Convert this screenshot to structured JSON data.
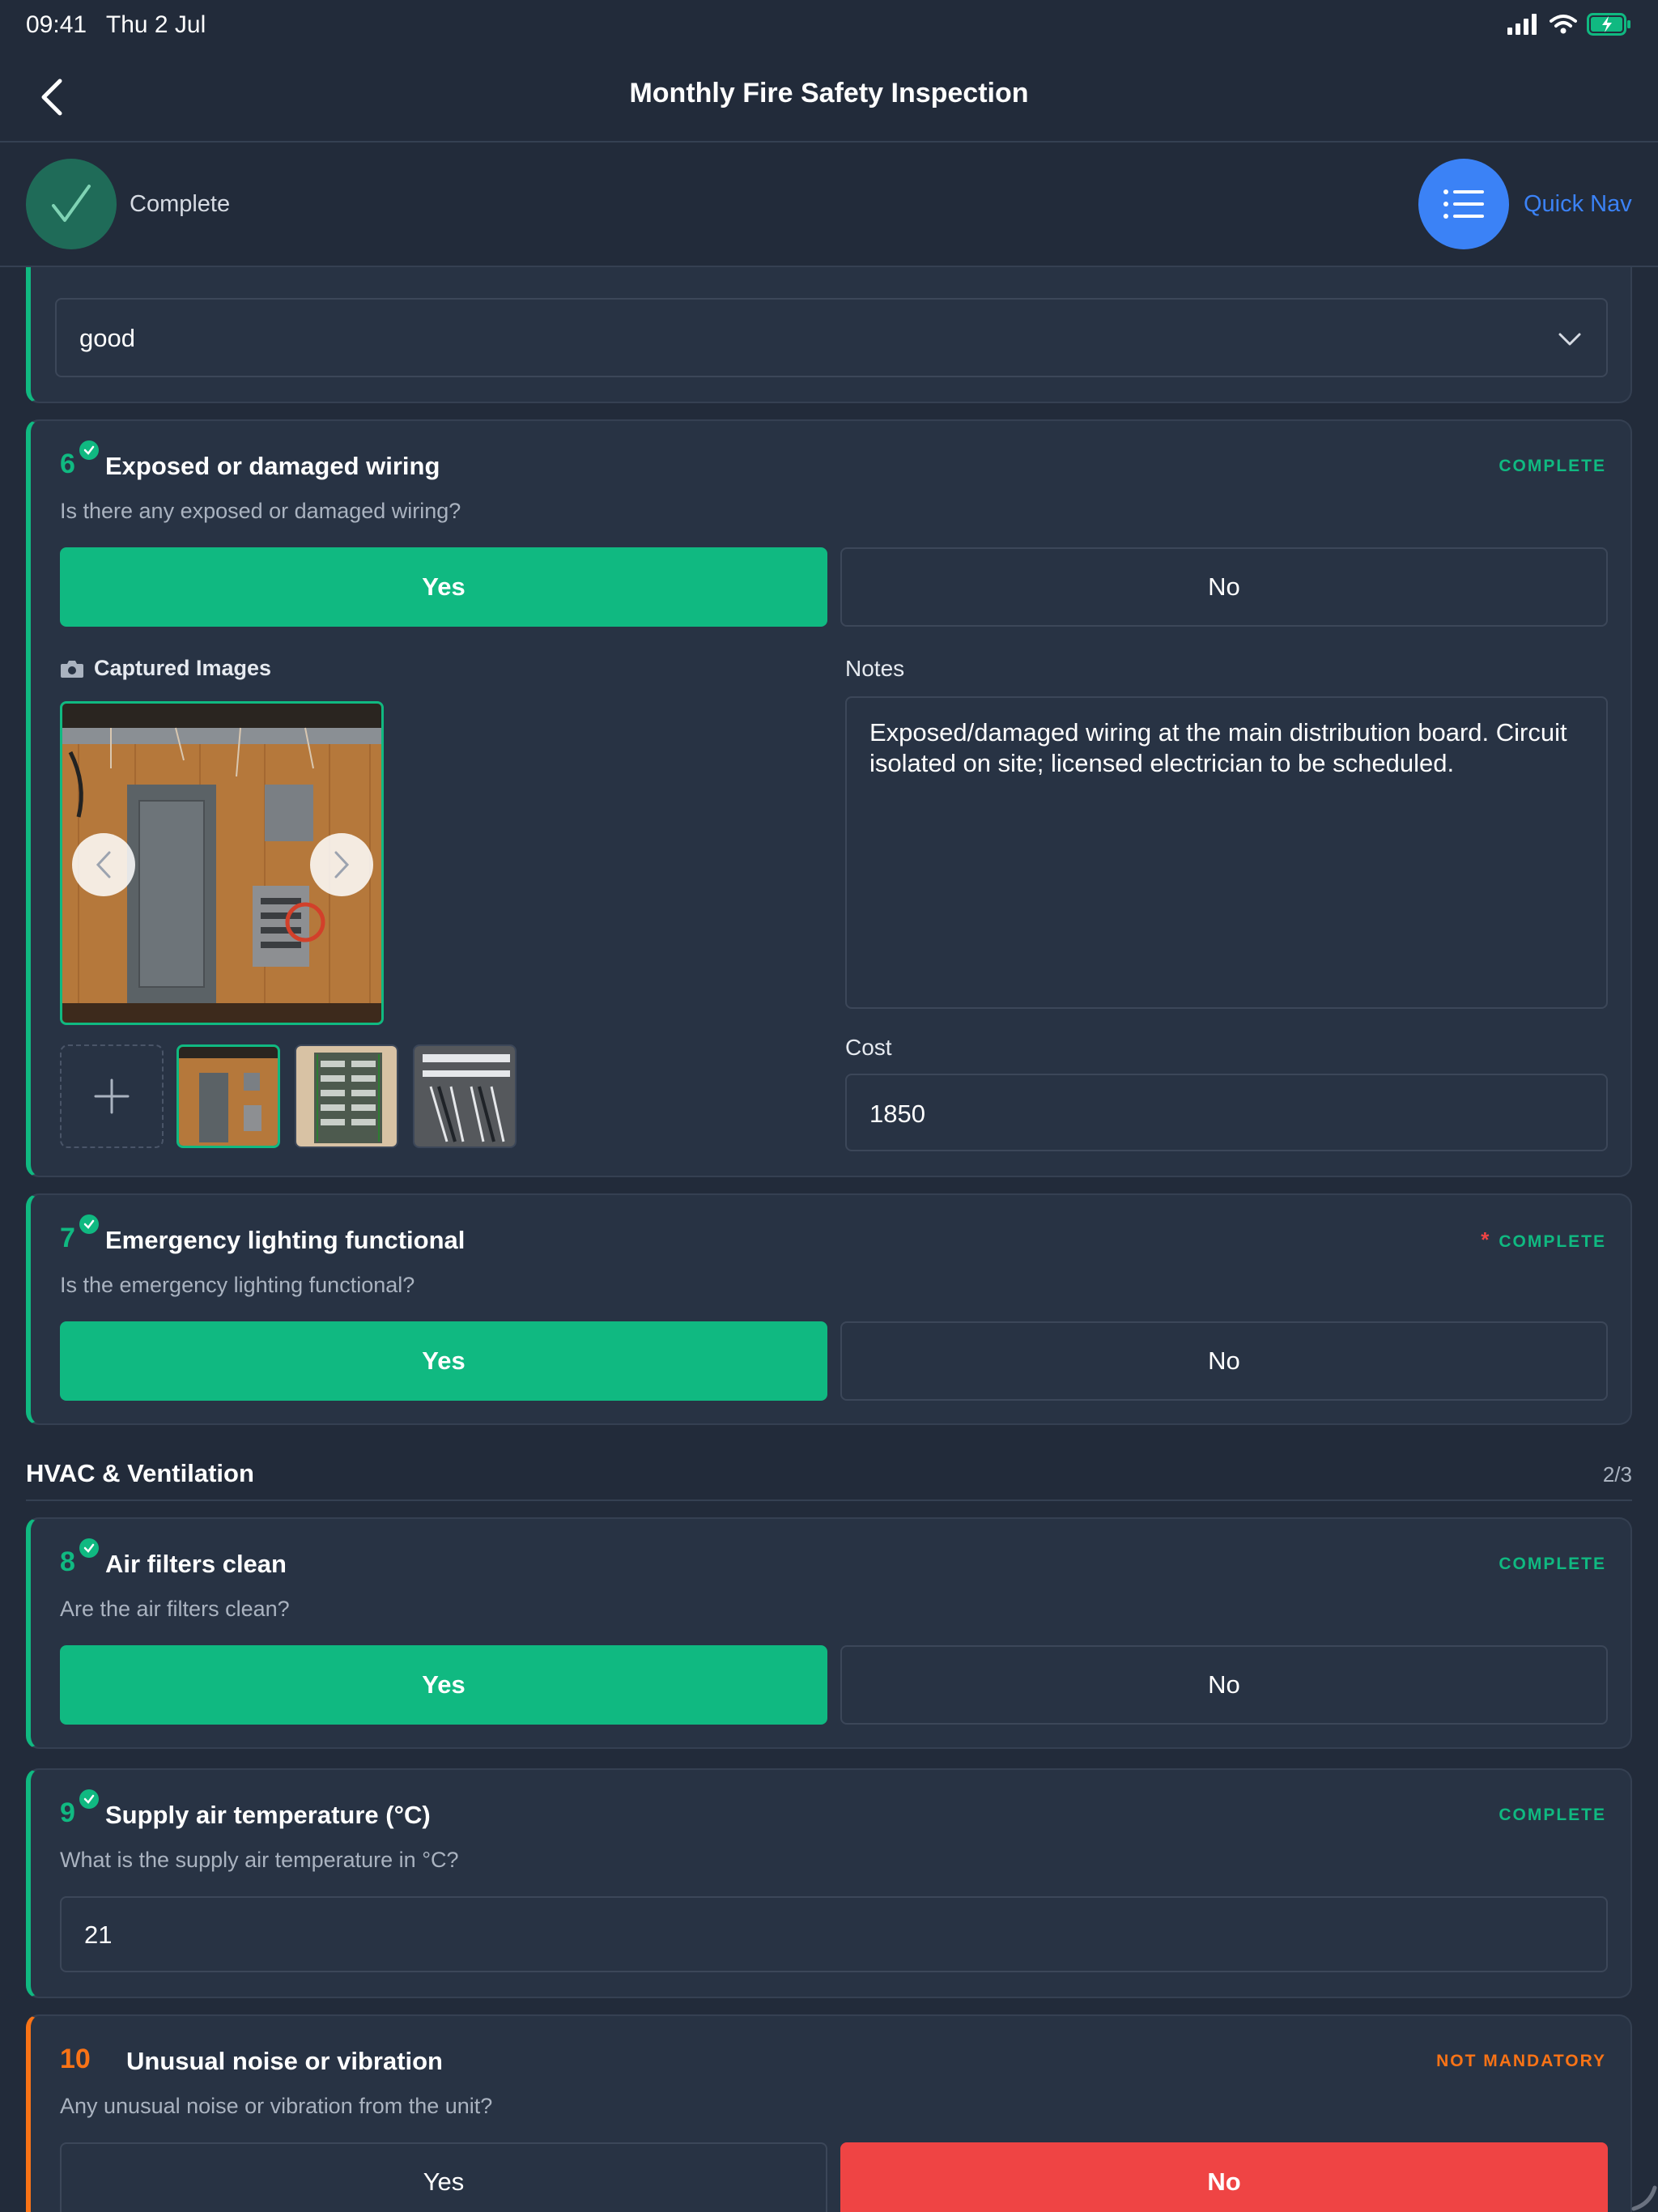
{
  "status_bar": {
    "time": "09:41",
    "date": "Thu 2 Jul"
  },
  "header": {
    "title": "Monthly Fire Safety Inspection",
    "back_icon": "chevron-left-icon"
  },
  "progress": {
    "label": "Complete",
    "quick_nav_label": "Quick Nav"
  },
  "prev_item": {
    "select_value": "good"
  },
  "q6": {
    "number": "6",
    "title": "Exposed or damaged wiring",
    "status": "COMPLETE",
    "description": "Is there any exposed or damaged wiring?",
    "yes_label": "Yes",
    "no_label": "No",
    "selected": "Yes",
    "images_label": "Captured Images",
    "notes_label": "Notes",
    "notes_value": "Exposed/damaged wiring at the main distribution board. Circuit isolated on site; licensed electrician to be scheduled.",
    "cost_label": "Cost",
    "cost_value": "1850"
  },
  "q7": {
    "number": "7",
    "title": "Emergency lighting functional",
    "required_mark": "*",
    "status": "COMPLETE",
    "description": "Is the emergency lighting functional?",
    "yes_label": "Yes",
    "no_label": "No",
    "selected": "Yes"
  },
  "section_hvac": {
    "title": "HVAC & Ventilation",
    "count": "2/3"
  },
  "q8": {
    "number": "8",
    "title": "Air filters clean",
    "status": "COMPLETE",
    "description": "Are the air filters clean?",
    "yes_label": "Yes",
    "no_label": "No",
    "selected": "Yes"
  },
  "q9": {
    "number": "9",
    "title": "Supply air temperature (°C)",
    "status": "COMPLETE",
    "description": "What is the supply air temperature in °C?",
    "value": "21"
  },
  "q10": {
    "number": "10",
    "title": "Unusual noise or vibration",
    "status": "NOT MANDATORY",
    "description": "Any unusual noise or vibration from the unit?",
    "yes_label": "Yes",
    "no_label": "No",
    "selected": "No"
  },
  "colors": {
    "background": "#222b3a",
    "card": "#283344",
    "accent_green": "#10b981",
    "accent_blue": "#3b82f6",
    "accent_orange": "#f97316",
    "danger_red": "#ef4444"
  }
}
